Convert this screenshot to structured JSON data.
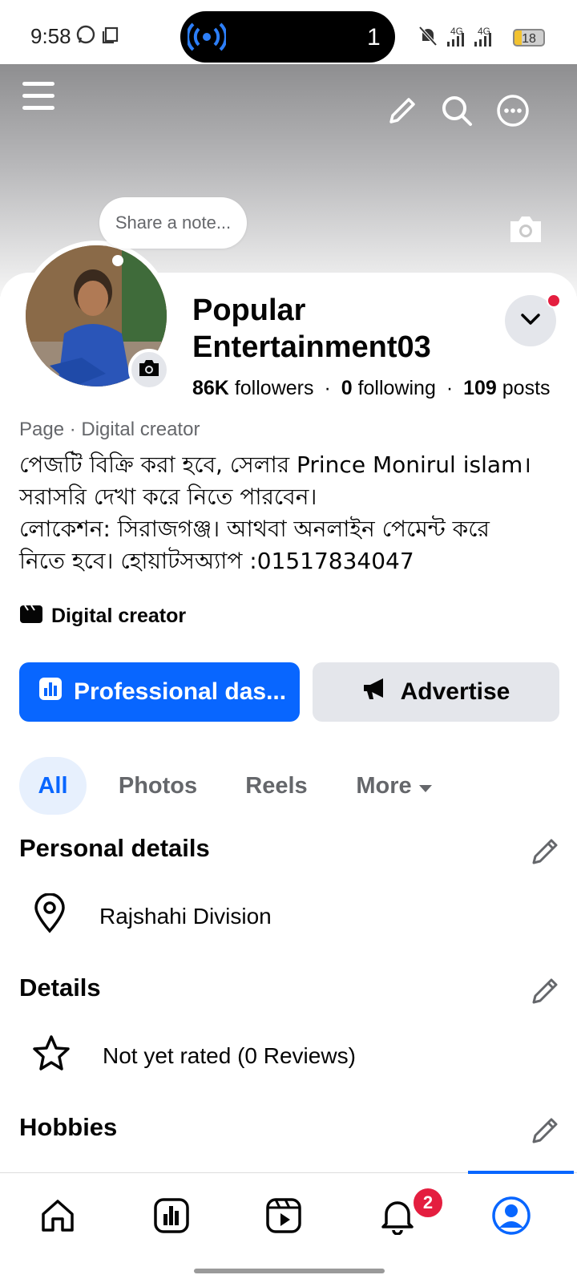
{
  "status_bar": {
    "time": "9:58",
    "pill_count": "1",
    "network_1": "4G",
    "network_2": "4G",
    "battery": "18"
  },
  "header": {
    "note_placeholder": "Share a note..."
  },
  "profile": {
    "name_line1": "Popular",
    "name_line2": "Entertainment03",
    "followers_count": "86K",
    "followers_label": "followers",
    "following_count": "0",
    "following_label": "following",
    "posts_count": "109",
    "posts_label": "posts",
    "separator": "·",
    "category": "Page · Digital creator",
    "bio_lines": [
      "পেজটি বিক্রি করা হবে, সেলার Prince Monirul islam।",
      "সরাসরি দেখা করে নিতে পারবেন।",
      "লোকেশন: সিরাজগঞ্জ। আথবা অনলাইন পেমেন্ট করে",
      "নিতে হবে। হোয়াটসঅ্যাপ :01517834047"
    ],
    "creator_label": "Digital creator"
  },
  "actions": {
    "dashboard_label": "Professional das...",
    "advertise_label": "Advertise"
  },
  "tabs": [
    {
      "label": "All"
    },
    {
      "label": "Photos"
    },
    {
      "label": "Reels"
    },
    {
      "label": "More"
    }
  ],
  "sections": {
    "personal_details_title": "Personal details",
    "location": "Rajshahi Division",
    "details_title": "Details",
    "rating": "Not yet rated (0 Reviews)",
    "hobbies_title": "Hobbies"
  },
  "bottom_nav": {
    "notifications_badge": "2"
  },
  "colors": {
    "accent": "#0866ff",
    "badge": "#e41e3f",
    "secondary_text": "#65676b",
    "button_grey": "#e4e6eb"
  }
}
